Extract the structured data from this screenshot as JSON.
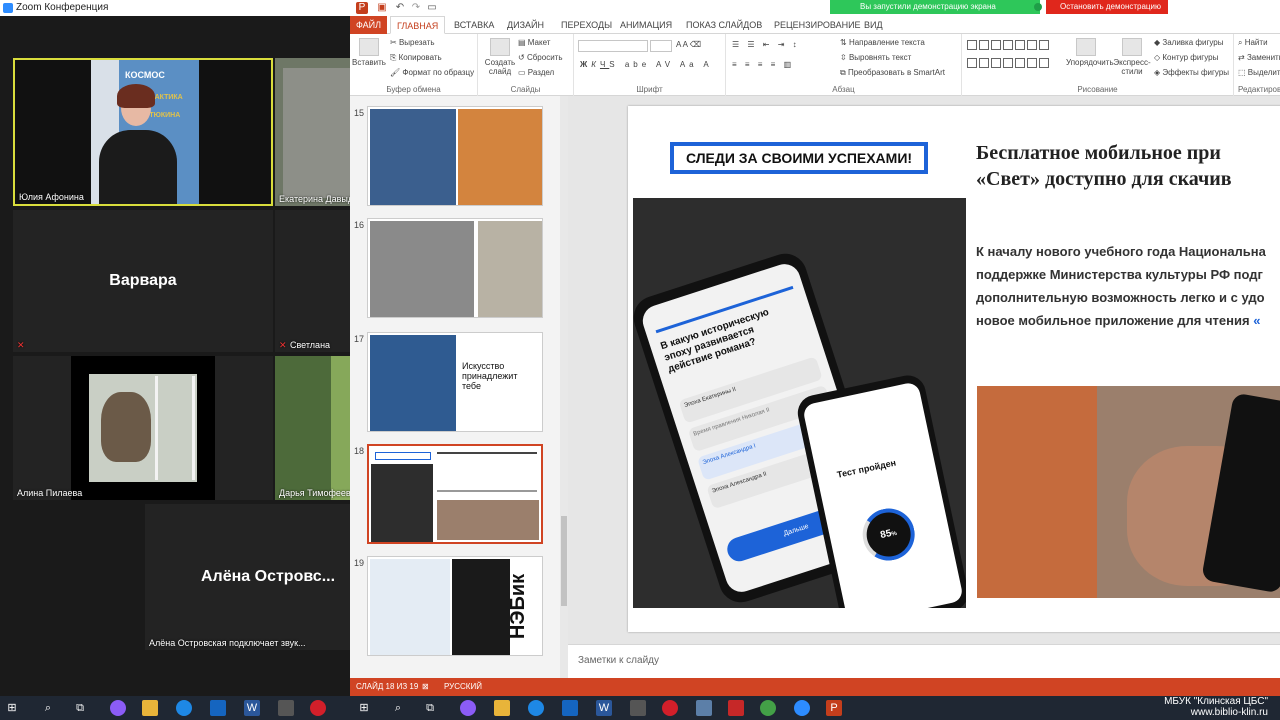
{
  "zoom": {
    "title": "Zoom Конференция",
    "participants": [
      {
        "name": "Юлия Афонина"
      },
      {
        "name": "Екатерина Давыдова"
      },
      {
        "name": "Варвара",
        "big_name": "Варвара"
      },
      {
        "name": "Светлана"
      },
      {
        "name": "Алина Пилаева"
      },
      {
        "name": "Дарья Тимофеева"
      },
      {
        "name": "Алёна Островская подключает звук...",
        "big_name": "Алёна  Островс..."
      }
    ],
    "poster_text": [
      "КОСМОС",
      "ГАЛАКТИКА",
      "УТЮКИНА"
    ]
  },
  "share": {
    "message": "Вы запустили демонстрацию экрана",
    "stop_label": "Остановить демонстрацию"
  },
  "ppt": {
    "tabs": [
      "ФАЙЛ",
      "ГЛАВНАЯ",
      "ВСТАВКА",
      "ДИЗАЙН",
      "ПЕРЕХОДЫ",
      "АНИМАЦИЯ",
      "ПОКАЗ СЛАЙДОВ",
      "РЕЦЕНЗИРОВАНИЕ",
      "ВИД"
    ],
    "ribbon": {
      "paste": "Вставить",
      "cut": "Вырезать",
      "copy": "Копировать",
      "format_painter": "Формат по образцу",
      "clipboard_label": "Буфер обмена",
      "new_slide": "Создать слайд",
      "layout": "Макет",
      "reset": "Сбросить",
      "section": "Раздел",
      "slides_label": "Слайды",
      "font_label": "Шрифт",
      "text_direction": "Направление текста",
      "align_text": "Выровнять текст",
      "smartart": "Преобразовать в SmartArt",
      "paragraph_label": "Абзац",
      "arrange": "Упорядочить",
      "quick_styles": "Экспресс-стили",
      "shape_fill": "Заливка фигуры",
      "shape_outline": "Контур фигуры",
      "shape_effects": "Эффекты фигуры",
      "drawing_label": "Рисование",
      "find": "Найти",
      "replace": "Заменить",
      "select": "Выделить",
      "editing_label": "Редактирование"
    },
    "thumbs": [
      {
        "num": "15"
      },
      {
        "num": "16"
      },
      {
        "num": "17",
        "heading": "Искусство принадлежит тебе"
      },
      {
        "num": "18"
      },
      {
        "num": "19",
        "vertical": "НЭБик"
      }
    ],
    "slide": {
      "slogan": "СЛЕДИ ЗА СВОИМИ УСПЕХАМИ!",
      "title_line1": "Бесплатное мобильное при",
      "title_line2": "«Свет» доступно для скачив",
      "body_line1": "К началу нового учебного года Национальна",
      "body_line2": "поддержке Министерства культуры РФ подг",
      "body_line3": "дополнительную возможность легко и с удо",
      "body_line4": "новое мобильное приложение для чтения ",
      "body_quote": "«",
      "phone_question": "В какую историческую эпоху развивается действие романа?",
      "phone_option1": "Эпоха Екатерины II",
      "phone_option2": "Время правления Николая II",
      "phone_option3": "Эпоха Александра I",
      "phone_option4": "Эпоха Александра II",
      "phone_button": "Дальше",
      "test_passed": "Тест пройден",
      "percent": "85",
      "percent_sign": "%"
    },
    "notes_placeholder": "Заметки к слайду",
    "status": {
      "slide_counter": "СЛАЙД 18 ИЗ 19",
      "language": "РУССКИЙ"
    }
  },
  "watermark": {
    "line1": "МБУК \"Клинская ЦБС\"",
    "line2": "www.biblio-klin.ru"
  }
}
